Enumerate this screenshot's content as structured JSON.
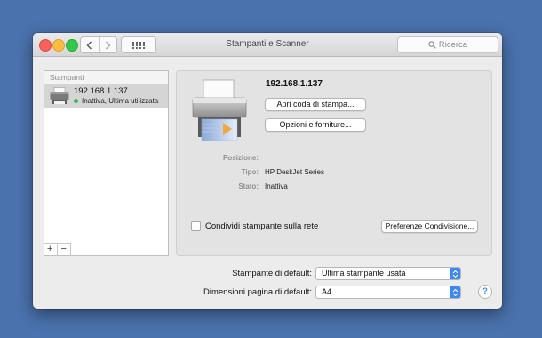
{
  "colors": {
    "desktop": "#4a72ad",
    "accent": "#3b87f5",
    "status_active": "#33b84a"
  },
  "window": {
    "title": "Stampanti e Scanner"
  },
  "toolbar": {
    "search_placeholder": "Ricerca",
    "back_icon": "chevron-left-icon",
    "forward_icon": "chevron-right-icon",
    "grid_icon": "grid-icon"
  },
  "sidebar": {
    "header": "Stampanti",
    "printers": [
      {
        "name": "192.168.1.137",
        "status": "Inattiva, Ultima utilizzata"
      }
    ],
    "add_label": "+",
    "remove_label": "−"
  },
  "detail": {
    "printer_name": "192.168.1.137",
    "open_queue_label": "Apri coda di stampa...",
    "options_label": "Opzioni e forniture...",
    "position_label": "Posizione:",
    "position_value": "",
    "type_label": "Tipo:",
    "type_value": "HP DeskJet Series",
    "state_label": "Stato:",
    "state_value": "Inattiva",
    "share_label": "Condividi stampante sulla rete",
    "share_checked": false,
    "share_prefs_label": "Preferenze Condivisione..."
  },
  "footer": {
    "default_printer_label": "Stampante di default:",
    "default_printer_value": "Ultima stampante usata",
    "paper_size_label": "Dimensioni pagina di default:",
    "paper_size_value": "A4",
    "help_label": "?"
  }
}
